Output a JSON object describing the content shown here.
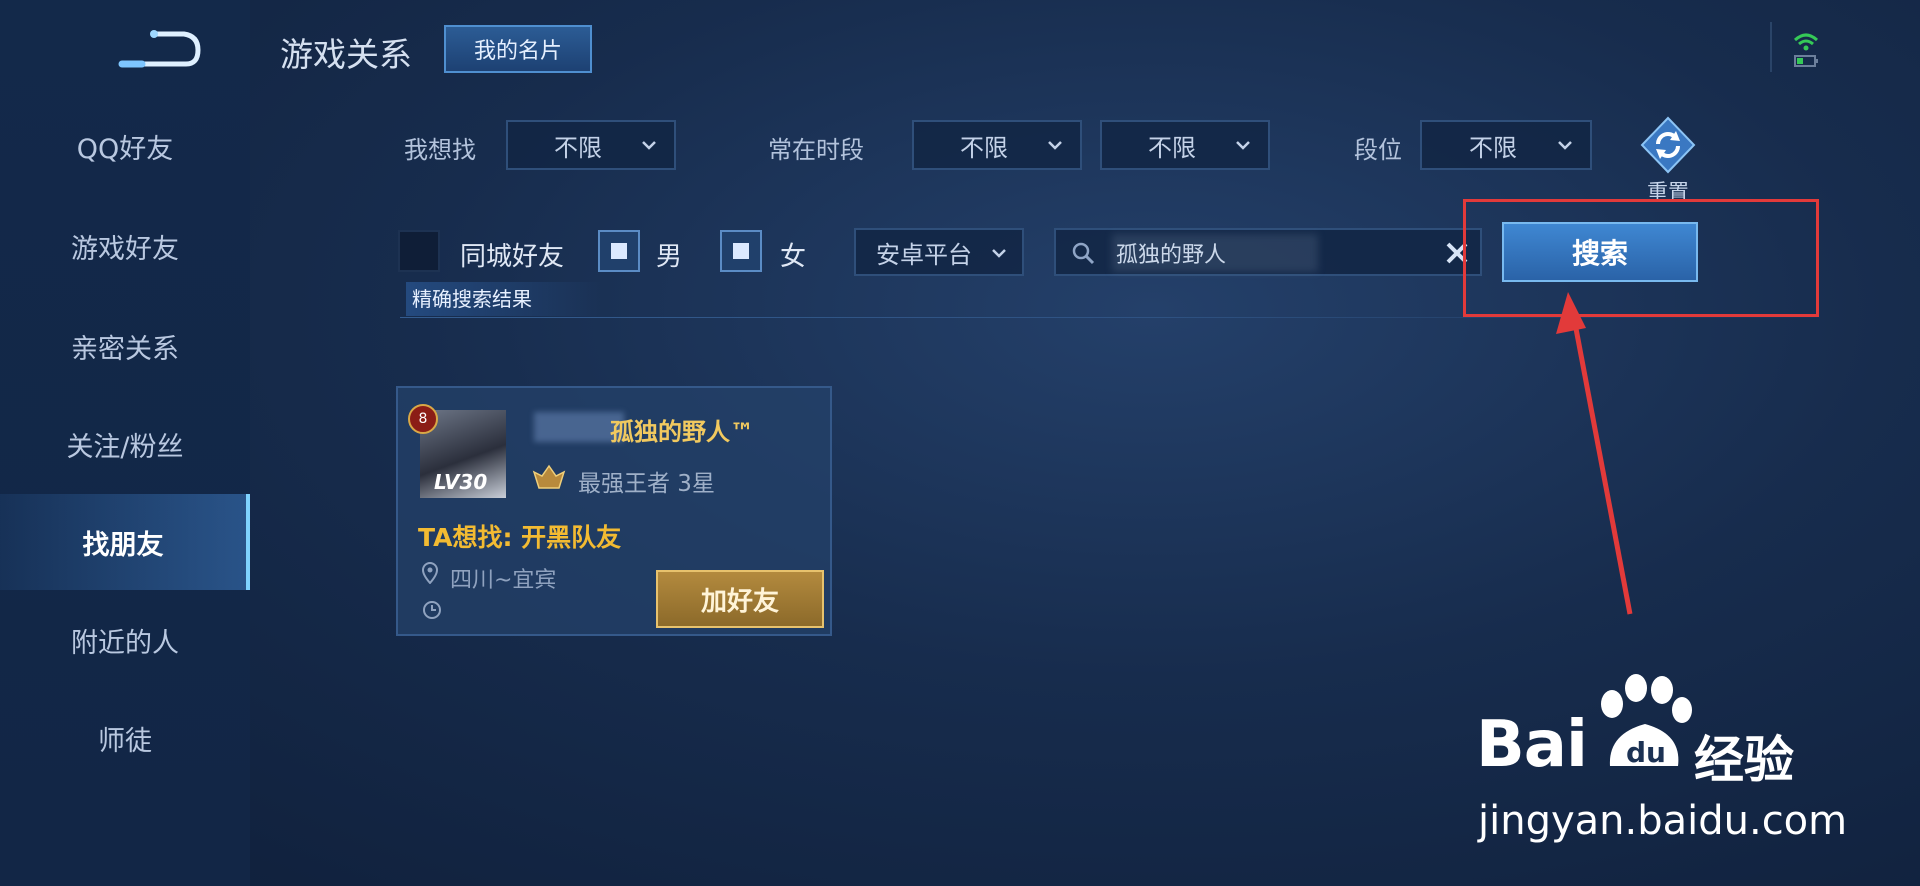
{
  "header": {
    "title": "游戏关系",
    "my_card": "我的名片"
  },
  "sidebar": {
    "items": [
      {
        "label": "QQ好友"
      },
      {
        "label": "游戏好友"
      },
      {
        "label": "亲密关系"
      },
      {
        "label": "关注/粉丝"
      },
      {
        "label": "找朋友",
        "active": true
      },
      {
        "label": "附近的人"
      },
      {
        "label": "师徒"
      }
    ]
  },
  "filters": {
    "want_label": "我想找",
    "want_value": "不限",
    "time_label": "常在时段",
    "time_value_1": "不限",
    "time_value_2": "不限",
    "rank_label": "段位",
    "rank_value": "不限",
    "reset_label": "重置"
  },
  "options": {
    "same_city": {
      "label": "同城好友",
      "checked": false
    },
    "male": {
      "label": "男",
      "checked": true
    },
    "female": {
      "label": "女",
      "checked": true
    },
    "platform": "安卓平台",
    "search_value": "孤独的野人",
    "search_button": "搜索",
    "exact_results": "精确搜索结果"
  },
  "result_card": {
    "rank_number": "8",
    "level": "LV30",
    "name": "孤独的野人™",
    "tier": "最强王者 3星",
    "wants": "TA想找: 开黑队友",
    "location": "四川~宜宾",
    "add_button": "加好友"
  },
  "watermark": {
    "brand": "Bai",
    "brand_cn": "经验",
    "url": "jingyan.baidu.com"
  },
  "colors": {
    "accent": "#3f87d2",
    "gold": "#f3bb32",
    "annotation": "#e23a3a"
  }
}
